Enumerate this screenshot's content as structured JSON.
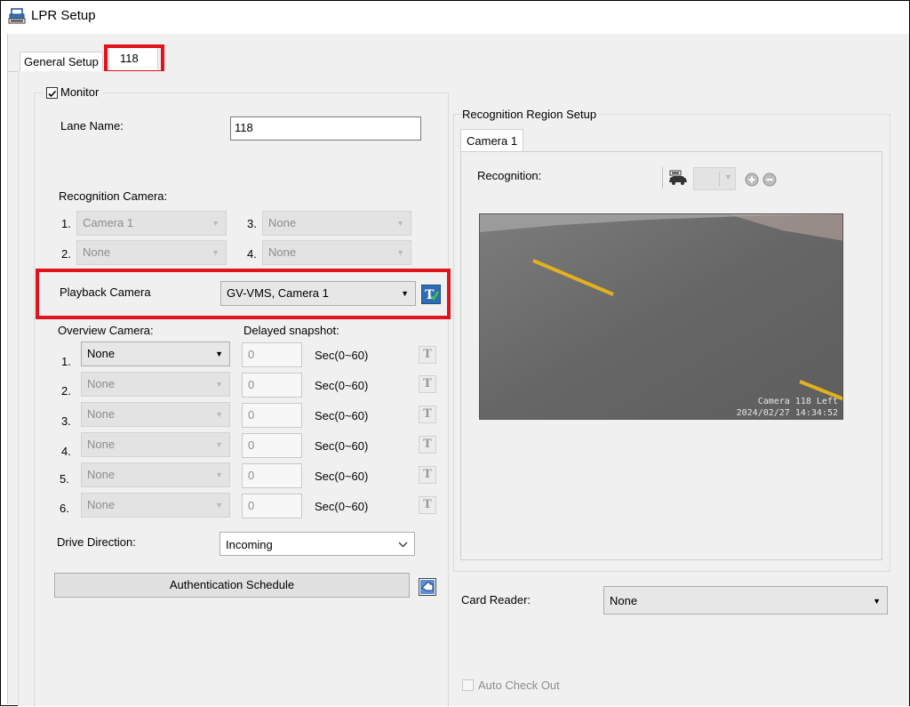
{
  "window": {
    "title": "LPR Setup"
  },
  "tabs": [
    {
      "label": "General Setup"
    },
    {
      "label": "118"
    }
  ],
  "monitor": {
    "label": "Monitor",
    "checked": true
  },
  "lane": {
    "label": "Lane Name:",
    "value": "118"
  },
  "recognition_camera": {
    "label": "Recognition Camera:",
    "slots": [
      {
        "num": "1.",
        "value": "Camera 1"
      },
      {
        "num": "2.",
        "value": "None"
      },
      {
        "num": "3.",
        "value": "None"
      },
      {
        "num": "4.",
        "value": "None"
      }
    ]
  },
  "playback": {
    "label": "Playback Camera",
    "value": "GV-VMS, Camera 1"
  },
  "overview": {
    "label": "Overview Camera:",
    "delay_label": "Delayed snapshot:",
    "rows": [
      {
        "num": "1.",
        "camera": "None",
        "delay": "0",
        "unit": "Sec(0~60)",
        "enabled": true
      },
      {
        "num": "2.",
        "camera": "None",
        "delay": "0",
        "unit": "Sec(0~60)",
        "enabled": false
      },
      {
        "num": "3.",
        "camera": "None",
        "delay": "0",
        "unit": "Sec(0~60)",
        "enabled": false
      },
      {
        "num": "4.",
        "camera": "None",
        "delay": "0",
        "unit": "Sec(0~60)",
        "enabled": false
      },
      {
        "num": "5.",
        "camera": "None",
        "delay": "0",
        "unit": "Sec(0~60)",
        "enabled": false
      },
      {
        "num": "6.",
        "camera": "None",
        "delay": "0",
        "unit": "Sec(0~60)",
        "enabled": false
      }
    ]
  },
  "drive_direction": {
    "label": "Drive Direction:",
    "value": "Incoming"
  },
  "auth_schedule": {
    "label": "Authentication Schedule"
  },
  "recognition_region": {
    "group_label": "Recognition Region Setup",
    "tab": "Camera 1",
    "recognition_label": "Recognition:",
    "overlay_line1": "Camera 118 Left",
    "overlay_line2": "2024/02/27 14:34:52"
  },
  "card_reader": {
    "label": "Card Reader:",
    "value": "None"
  },
  "auto_checkout": {
    "label": "Auto Check Out",
    "checked": false
  },
  "colors": {
    "highlight": "#e2131a",
    "road": "#6c6c6c",
    "lane_mark": "#e2b11c"
  }
}
